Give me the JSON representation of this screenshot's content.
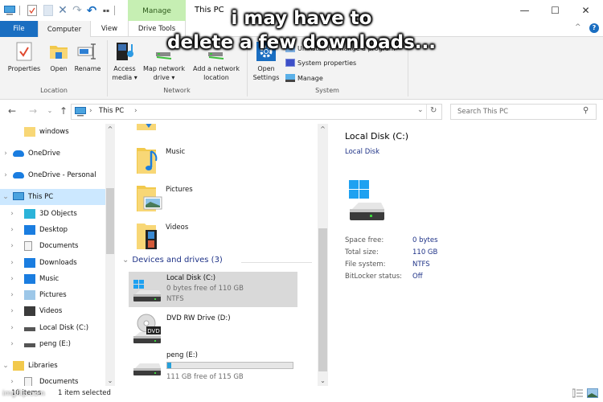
{
  "window": {
    "title": "This PC",
    "context_tab": "Manage",
    "controls": {
      "minimize": "—",
      "maximize": "☐",
      "close": "✕"
    }
  },
  "quick_access_toolbar": {
    "icons": [
      "computer-icon",
      "properties-icon",
      "new-folder-icon",
      "delete-icon",
      "redo-icon",
      "undo-icon",
      "customize-icon"
    ],
    "more_label": "▪▪"
  },
  "ribbon": {
    "tabs": [
      {
        "label": "File"
      },
      {
        "label": "Computer"
      },
      {
        "label": "View"
      },
      {
        "label": "Drive Tools"
      }
    ],
    "collapse_glyph": "^",
    "help_glyph": "?",
    "groups": {
      "location": {
        "label": "Location",
        "buttons": [
          {
            "label": "Properties",
            "icon": "properties-icon"
          },
          {
            "label": "Open",
            "icon": "open-folder-icon"
          },
          {
            "label": "Rename",
            "icon": "rename-icon"
          }
        ]
      },
      "network": {
        "label": "Network",
        "buttons": [
          {
            "label": "Access",
            "label2": "media ▾",
            "icon": "media-icon"
          },
          {
            "label": "Map network",
            "label2": "drive ▾",
            "icon": "network-drive-icon"
          },
          {
            "label": "Add a network",
            "label2": "location",
            "icon": "network-location-icon"
          }
        ]
      },
      "system": {
        "label": "System",
        "open_settings": {
          "label": "Open",
          "label2": "Settings"
        },
        "small_buttons": [
          {
            "label": "Uninstall or change a program"
          },
          {
            "label": "System properties"
          },
          {
            "label": "Manage"
          }
        ]
      }
    }
  },
  "navigation": {
    "back": "←",
    "forward": "→",
    "recent": "⌄",
    "up": "↑",
    "breadcrumb": [
      "This PC"
    ],
    "breadcrumb_sep": "›",
    "dropdown": "⌄",
    "refresh": "↻",
    "search_placeholder": "Search This PC",
    "search_icon": "⚲"
  },
  "nav_pane": {
    "items": [
      {
        "label": "windows",
        "icon": "folder-icon",
        "indent": 2,
        "chevron": ""
      },
      {
        "label": "OneDrive",
        "icon": "cloud-icon",
        "indent": 1,
        "chevron": "›"
      },
      {
        "label": "OneDrive - Personal",
        "icon": "cloud-icon",
        "indent": 1,
        "chevron": "›"
      },
      {
        "label": "This PC",
        "icon": "computer-icon",
        "indent": 1,
        "chevron": "⌄",
        "selected": true
      },
      {
        "label": "3D Objects",
        "icon": "3d-objects-icon",
        "indent": 2,
        "chevron": "›"
      },
      {
        "label": "Desktop",
        "icon": "desktop-icon",
        "indent": 2,
        "chevron": "›"
      },
      {
        "label": "Documents",
        "icon": "documents-icon",
        "indent": 2,
        "chevron": "›"
      },
      {
        "label": "Downloads",
        "icon": "downloads-icon",
        "indent": 2,
        "chevron": "›"
      },
      {
        "label": "Music",
        "icon": "music-icon",
        "indent": 2,
        "chevron": "›"
      },
      {
        "label": "Pictures",
        "icon": "pictures-icon",
        "indent": 2,
        "chevron": "›"
      },
      {
        "label": "Videos",
        "icon": "videos-icon",
        "indent": 2,
        "chevron": "›"
      },
      {
        "label": "Local Disk (C:)",
        "icon": "local-disk-icon",
        "indent": 2,
        "chevron": "›"
      },
      {
        "label": "peng (E:)",
        "icon": "drive-icon",
        "indent": 2,
        "chevron": "›"
      },
      {
        "label": "Libraries",
        "icon": "libraries-icon",
        "indent": 1,
        "chevron": "⌄"
      },
      {
        "label": "Documents",
        "icon": "documents-icon",
        "indent": 2,
        "chevron": "›"
      }
    ]
  },
  "content": {
    "folders": [
      {
        "label": "Music",
        "icon": "music-folder-icon"
      },
      {
        "label": "Pictures",
        "icon": "pictures-folder-icon"
      },
      {
        "label": "Videos",
        "icon": "videos-folder-icon"
      }
    ],
    "devices_header": "Devices and drives (3)",
    "devices_chevron": "⌄",
    "drives": [
      {
        "name": "Local Disk (C:)",
        "line2": "0 bytes free of 110 GB",
        "line3": "NTFS",
        "selected": true,
        "icon": "local-disk-icon"
      },
      {
        "name": "DVD RW Drive (D:)",
        "icon": "dvd-drive-icon",
        "badge": "DVD"
      },
      {
        "name": "peng (E:)",
        "line2": "111 GB free of 115 GB",
        "used_fraction": 0.035,
        "icon": "drive-icon"
      }
    ]
  },
  "details_pane": {
    "title": "Local Disk (C:)",
    "subtitle": "Local Disk",
    "rows": [
      {
        "key": "Space free:",
        "value": "0 bytes"
      },
      {
        "key": "Total size:",
        "value": "110 GB"
      },
      {
        "key": "File system:",
        "value": "NTFS"
      },
      {
        "key": "BitLocker status:",
        "value": "Off"
      }
    ]
  },
  "status_bar": {
    "item_count": "10 items",
    "selection": "1 item selected"
  },
  "overlay": {
    "caption_line1": "i may have to",
    "caption_line2": "delete a few downloads...",
    "watermark": "imgflip.com"
  },
  "colors": {
    "accent": "#1a6ec1",
    "manage_tab": "#c6efb3",
    "selection": "#cce8ff",
    "progress": "#26a0da",
    "link_blue": "#1e3287"
  }
}
